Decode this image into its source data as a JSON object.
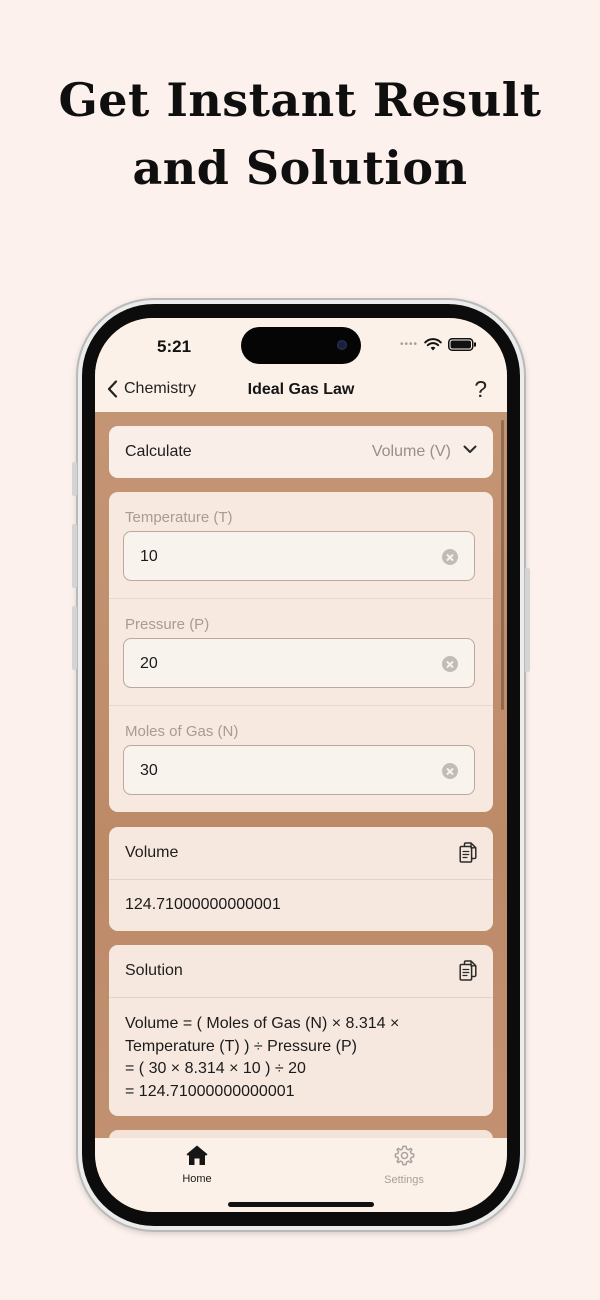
{
  "headline": {
    "line1": "Get Instant Result",
    "line2": "and Solution"
  },
  "status_bar": {
    "time": "5:21"
  },
  "navbar": {
    "back_label": "Chemistry",
    "title": "Ideal Gas Law",
    "help_label": "?"
  },
  "calculate": {
    "label": "Calculate",
    "selected": "Volume (V)"
  },
  "fields": [
    {
      "label": "Temperature (T)",
      "value": "10"
    },
    {
      "label": "Pressure (P)",
      "value": "20"
    },
    {
      "label": "Moles of Gas (N)",
      "value": "30"
    }
  ],
  "result": {
    "title": "Volume",
    "value": "124.71000000000001"
  },
  "solution": {
    "title": "Solution",
    "lines": [
      "Volume = ( Moles of Gas (N) × 8.314 ×",
      "Temperature (T) ) ÷ Pressure (P)",
      "= ( 30 × 8.314 × 10 ) ÷ 20",
      "= 124.71000000000001"
    ]
  },
  "tabs": {
    "home": "Home",
    "settings": "Settings"
  },
  "colors": {
    "page_background": "#fcf1ec",
    "content_background": "#c08f6f",
    "card_background": "#f6e8df",
    "accent_dark": "#1b1b1b"
  },
  "icons": [
    "back-chevron-icon",
    "chevron-down-icon",
    "clear-icon",
    "copy-icon",
    "house-icon",
    "gear-icon",
    "wifi-icon",
    "battery-icon",
    "cellular-dots-icon"
  ]
}
